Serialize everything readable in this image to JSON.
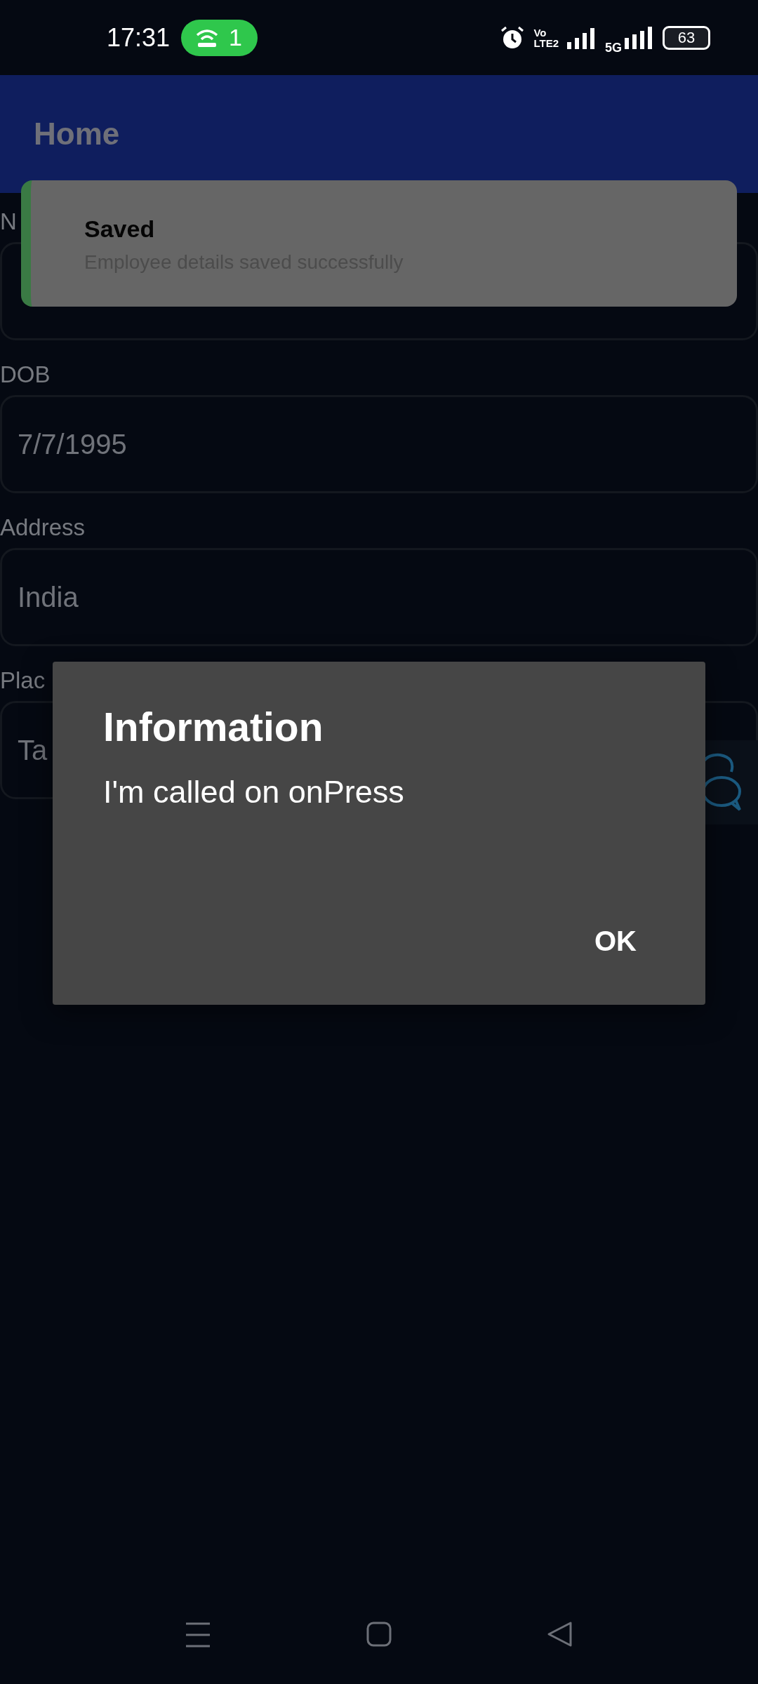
{
  "status_bar": {
    "time": "17:31",
    "hotspot_count": "1",
    "volte_top": "Vo",
    "volte_bottom": "LTE2",
    "network": "5G",
    "battery": "63"
  },
  "app_bar": {
    "title": "Home"
  },
  "form": [
    {
      "label": "N"
    },
    {
      "label": "DOB",
      "value": "7/7/1995"
    },
    {
      "label": "Address",
      "value": "India"
    },
    {
      "label": "Plac",
      "value": "Ta"
    }
  ],
  "toast": {
    "title": "Saved",
    "message": "Employee details saved successfully"
  },
  "dialog": {
    "title": "Information",
    "message": "I'm called on onPress",
    "buttons": [
      "OK"
    ]
  }
}
